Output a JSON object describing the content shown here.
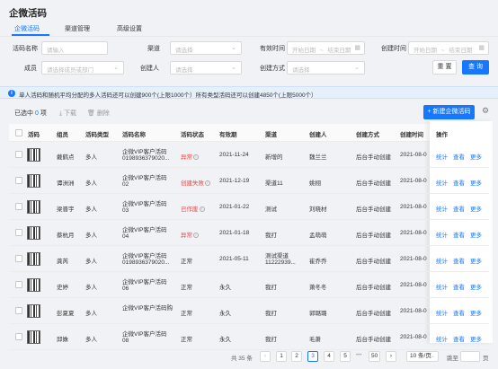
{
  "page": {
    "title": "企微活码"
  },
  "tabs": [
    {
      "label": "企微活码"
    },
    {
      "label": "渠道管理"
    },
    {
      "label": "高级设置"
    }
  ],
  "filters": {
    "code_name_label": "活码名称",
    "code_name_placeholder": "请输入",
    "channel_label": "渠道",
    "channel_placeholder": "请选择",
    "validity_label": "有效时间",
    "validity_start": "开始日期",
    "validity_sep": "~",
    "validity_end": "结束日期",
    "create_time_label": "创建时间",
    "create_start": "开始日期",
    "create_sep": "~",
    "create_end": "结束日期",
    "member_label": "成员",
    "member_placeholder": "请选择成员或部门",
    "creator_label": "创建人",
    "creator_placeholder": "请选择",
    "create_method_label": "创建方式",
    "create_method_placeholder": "请选择",
    "reset_label": "重 置",
    "query_label": "查 询"
  },
  "notice": {
    "icon": "i",
    "text": "单人活码和随机平均分配的多人活码还可以创建900个(上限1000个）所有类型活码还可以创建4850个(上限5000个）"
  },
  "toolbar": {
    "selected_prefix": "已选中",
    "selected_count": "0",
    "selected_suffix": "项",
    "download_label": "下载",
    "delete_label": "删除",
    "new_label": "+ 新建企微活码"
  },
  "table": {
    "headers": [
      "活码",
      "组员",
      "活码类型",
      "活码名称",
      "活码状态",
      "有效期",
      "渠道",
      "创建人",
      "创建方式",
      "创建时间",
      "操作"
    ],
    "rows": [
      {
        "member": "戴鹤点",
        "type": "多人",
        "name1": "企微VIP客户活码",
        "name2": "0198936379020...",
        "status": "异常",
        "status_color": "#e54545",
        "status_info": true,
        "validity": "2021-11-24",
        "channel1": "新增的",
        "channel2": "",
        "creator": "魏兰兰",
        "method": "后台手动创建",
        "time": "2021-08-0"
      },
      {
        "member": "谭洲洲",
        "type": "多人",
        "name1": "企微VIP客户活码",
        "name2": "02",
        "status": "创建失败",
        "status_color": "#e54545",
        "status_info": true,
        "validity": "2021-12-19",
        "channel1": "渠道11",
        "channel2": "",
        "creator": "姚栩",
        "method": "后台手动创建",
        "time": "2021-08-0"
      },
      {
        "member": "梁晋宇",
        "type": "多人",
        "name1": "企微VIP客户活码",
        "name2": "03",
        "status": "已作废",
        "status_color": "#e54545",
        "status_info": true,
        "validity": "2021-01-22",
        "channel1": "测试",
        "channel2": "",
        "creator": "刘晓材",
        "method": "后台手动创建",
        "time": "2021-08-0"
      },
      {
        "member": "蔡杭月",
        "type": "多人",
        "name1": "企微VIP客户活码",
        "name2": "04",
        "status": "异常",
        "status_color": "#e54545",
        "status_info": true,
        "validity": "2021-01-18",
        "channel1": "我打",
        "channel2": "",
        "creator": "孟萌萌",
        "method": "后台手动创建",
        "time": "2021-08-0"
      },
      {
        "member": "龚芮",
        "type": "多人",
        "name1": "企微VIP客户活码",
        "name2": "0198936379020...",
        "status": "正常",
        "status_color": "#333333",
        "status_info": false,
        "validity": "2021-05-11",
        "channel1": "测试渠道",
        "channel2": "11222939...",
        "creator": "崔乔乔",
        "method": "后台手动创建",
        "time": "2021-08-0"
      },
      {
        "member": "史婷",
        "type": "多人",
        "name1": "企微VIP客户活码",
        "name2": "06",
        "status": "正常",
        "status_color": "#333333",
        "status_info": false,
        "validity": "永久",
        "channel1": "我打",
        "channel2": "",
        "creator": "萧冬冬",
        "method": "后台手动创建",
        "time": "2021-08-0"
      },
      {
        "member": "彭夏夏",
        "type": "多人",
        "name1": "企微VIP客户活码购",
        "name2": "",
        "status": "正常",
        "status_color": "#333333",
        "status_info": false,
        "validity": "永久",
        "channel1": "我打",
        "channel2": "",
        "creator": "郭璐璐",
        "method": "后台手动创建",
        "time": "2021-08-0"
      },
      {
        "member": "邱姝",
        "type": "多人",
        "name1": "企微VIP客户活码",
        "name2": "08",
        "status": "正常",
        "status_color": "#333333",
        "status_info": false,
        "validity": "永久",
        "channel1": "我打",
        "channel2": "",
        "creator": "毛萧",
        "method": "后台手动创建",
        "time": "2021-08-0"
      }
    ],
    "actions": {
      "stats": "统计",
      "view": "查看",
      "more": "更多"
    }
  },
  "pagination": {
    "total": "共 35 条",
    "prev": "‹",
    "pages": [
      "1",
      "2",
      "3",
      "4",
      "5"
    ],
    "active_page": "3",
    "ellipsis": "•••",
    "last": "50",
    "next": "›",
    "page_size": "10 条/页",
    "jump_label": "跳至",
    "jump_suffix": "页"
  }
}
